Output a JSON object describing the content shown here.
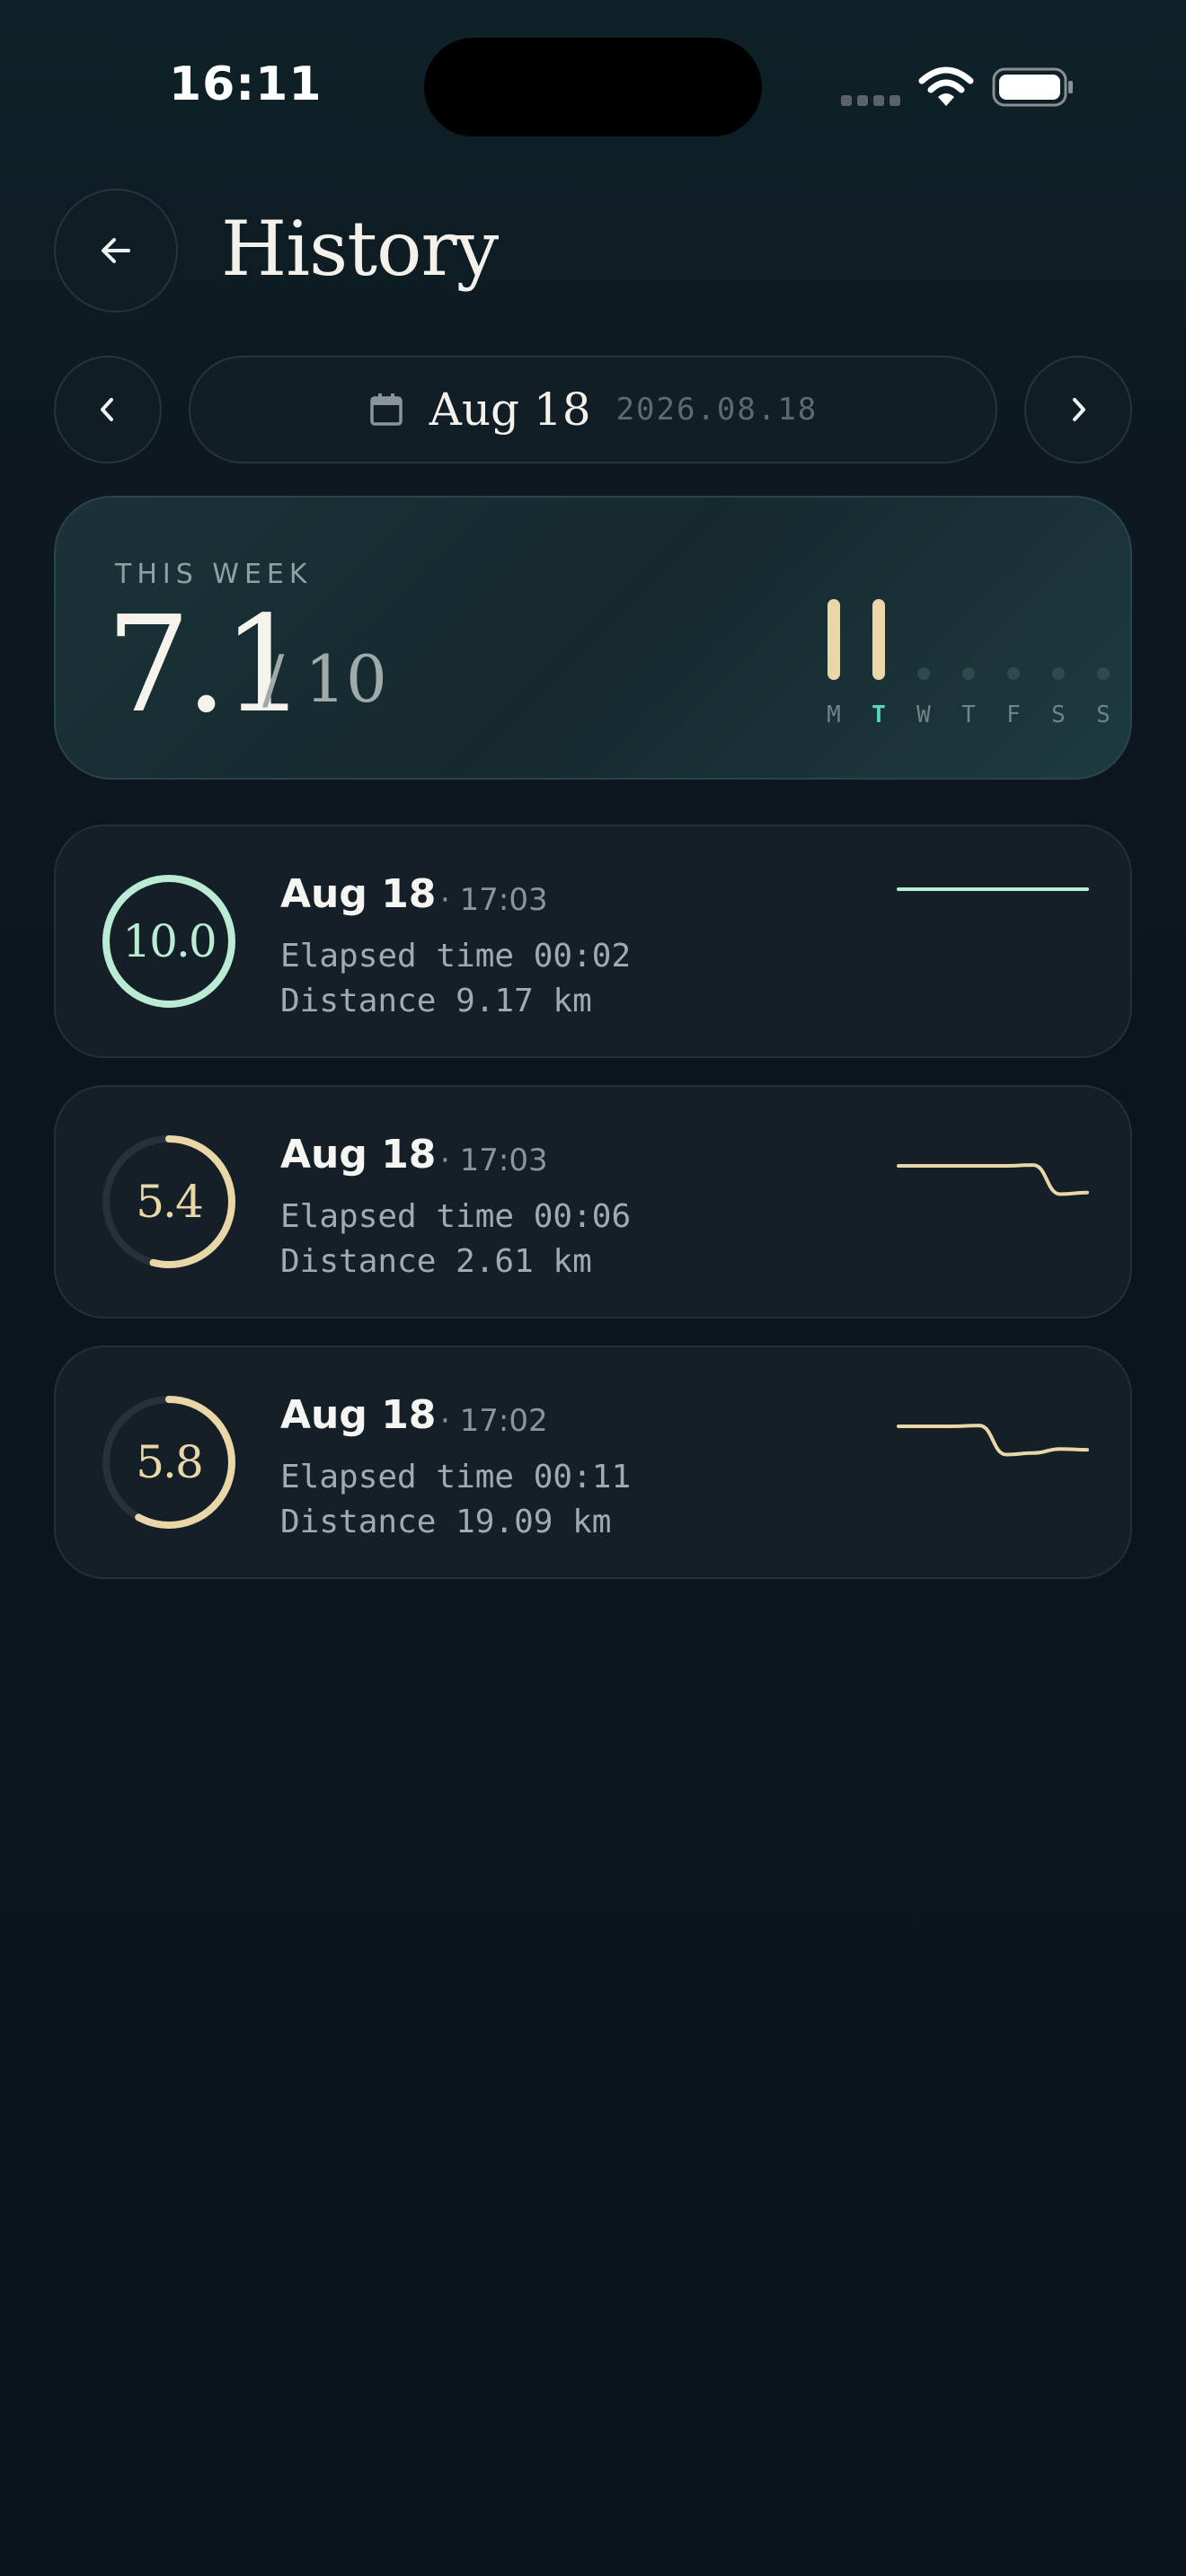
{
  "status_bar": {
    "time": "16:11"
  },
  "header": {
    "title": "History",
    "back_icon": "arrow-left-icon"
  },
  "date_nav": {
    "prev_icon": "chevron-left-icon",
    "next_icon": "chevron-right-icon",
    "calendar_icon": "calendar-icon",
    "date": "Aug 18",
    "date_full": "2026.08.18"
  },
  "week": {
    "label": "THIS WEEK",
    "score": "7.1",
    "max": "/ 10",
    "days": [
      {
        "letter": "M",
        "active": true,
        "today": false
      },
      {
        "letter": "T",
        "active": true,
        "today": true
      },
      {
        "letter": "W",
        "active": false,
        "today": false
      },
      {
        "letter": "T",
        "active": false,
        "today": false
      },
      {
        "letter": "F",
        "active": false,
        "today": false
      },
      {
        "letter": "S",
        "active": false,
        "today": false
      },
      {
        "letter": "S",
        "active": false,
        "today": false
      }
    ]
  },
  "sessions": [
    {
      "score": "10.0",
      "progress": 1.0,
      "color": "#b9ecd2",
      "date": "Aug 18",
      "time": "· 17:03",
      "elapsed": "Elapsed time 00:02",
      "distance": "Distance 9.17 km",
      "spark": [
        1,
        1,
        1,
        1,
        1,
        1,
        1,
        1
      ]
    },
    {
      "score": "5.4",
      "progress": 0.54,
      "color": "#ead7a8",
      "date": "Aug 18",
      "time": "· 17:03",
      "elapsed": "Elapsed time 00:06",
      "distance": "Distance 2.61 km",
      "spark": [
        0.8,
        0.8,
        0.8,
        0.8,
        0.8,
        0.81,
        0.45,
        0.47
      ]
    },
    {
      "score": "5.8",
      "progress": 0.58,
      "color": "#ead7a8",
      "date": "Aug 18",
      "time": "· 17:02",
      "elapsed": "Elapsed time 00:11",
      "distance": "Distance 19.09 km",
      "spark": [
        0.8,
        0.8,
        0.8,
        0.81,
        0.45,
        0.47,
        0.52,
        0.51
      ]
    }
  ],
  "colors": {
    "accent_mint": "#b9ecd2",
    "accent_sand": "#ead7a8",
    "today_teal": "#5ad6c3"
  }
}
